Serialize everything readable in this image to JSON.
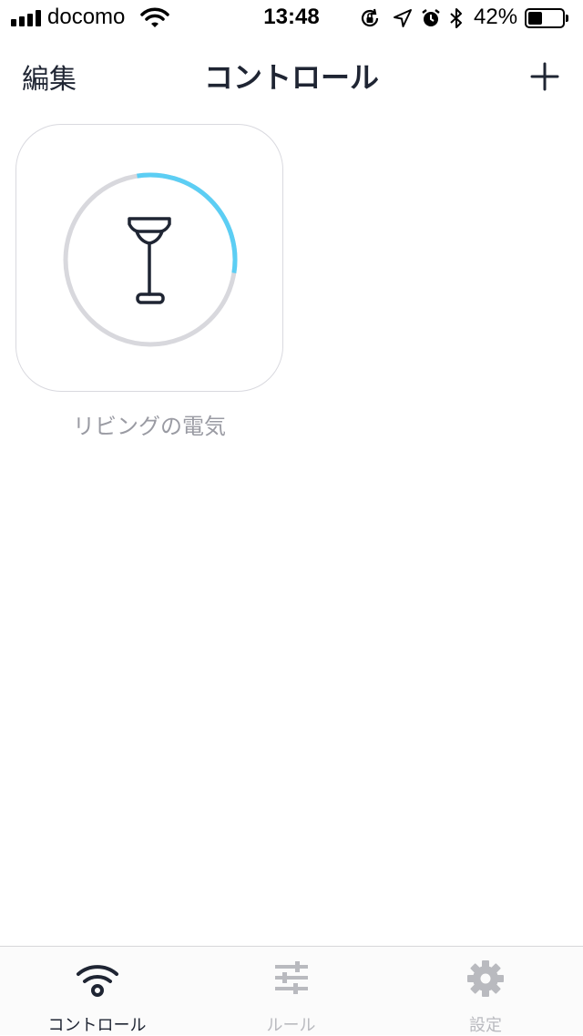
{
  "status_bar": {
    "carrier": "docomo",
    "time": "13:48",
    "battery_percent": "42%",
    "battery_level": 0.42,
    "icons": [
      "signal-icon",
      "wifi-icon",
      "orientation-lock-icon",
      "location-icon",
      "alarm-icon",
      "bluetooth-icon",
      "battery-icon"
    ]
  },
  "nav": {
    "edit_label": "編集",
    "title": "コントロール",
    "add_icon": "plus-icon"
  },
  "devices": [
    {
      "label": "リビングの電気",
      "icon": "floor-lamp-icon",
      "level": 0.3,
      "ring_color": "#5ccef4",
      "track_color": "#d8d8dd"
    }
  ],
  "tabs": [
    {
      "label": "コントロール",
      "icon": "wifi-icon",
      "active": true
    },
    {
      "label": "ルール",
      "icon": "sliders-icon",
      "active": false
    },
    {
      "label": "設定",
      "icon": "gear-icon",
      "active": false
    }
  ],
  "colors": {
    "text_primary": "#1f2533",
    "text_muted": "#9a9ba3",
    "tab_inactive": "#b9babf",
    "accent": "#5ccef4"
  }
}
